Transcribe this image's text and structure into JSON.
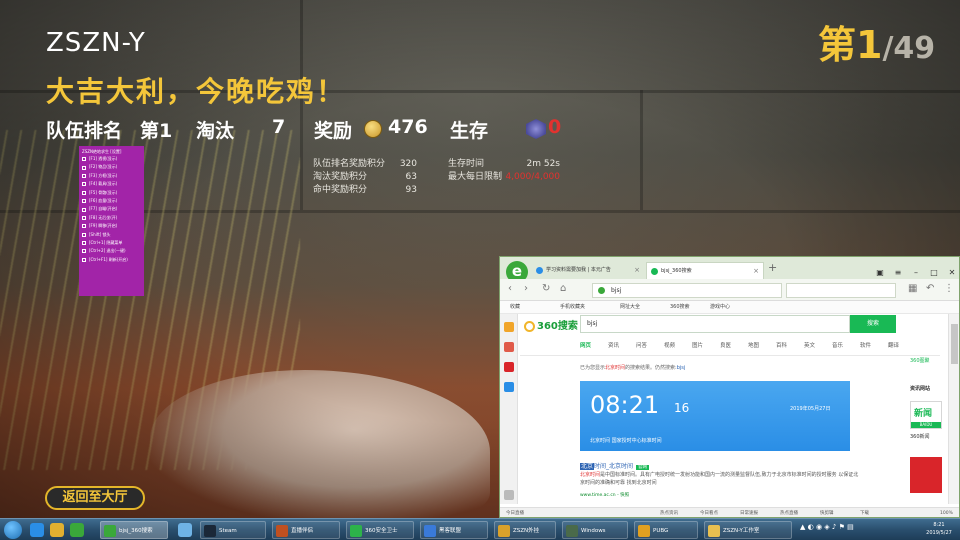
{
  "hud": {
    "player_name": "ZSZN-Y",
    "headline": "大吉大利，今晚吃鸡！",
    "rank_current": "第1",
    "rank_total": "/49",
    "team_rank_label": "队伍排名",
    "team_rank_value": "第1",
    "kills_label": "淘汰",
    "kills_value": "7",
    "reward_label": "奖励",
    "reward_value": "476",
    "survive_label": "生存",
    "survive_value": "0",
    "details_left": [
      {
        "label": "队伍排名奖励积分",
        "value": "320"
      },
      {
        "label": "淘汰奖励积分",
        "value": "63"
      },
      {
        "label": "命中奖励积分",
        "value": "93"
      }
    ],
    "details_right": [
      {
        "label": "生存时间",
        "value": "2m 52s"
      },
      {
        "label": "最大每日限制",
        "value": "4,000/4,000"
      }
    ],
    "back_button": "返回至大厅",
    "colors": {
      "gold": "#f4c63a",
      "red": "#e2322f"
    }
  },
  "mod_menu": {
    "title": "ZSZN绝地求生 [设置]",
    "items": [
      "[F1] 透视(显示)",
      "[F2] 物品(显示)",
      "[F3] 方框(显示)",
      "[F4] 载具(显示)",
      "[F5] 骨骼(显示)",
      "[F6] 血量(显示)",
      "[F7] 自瞄(开启)",
      "[F8] 无后坐(开)",
      "[F9] 瞬移(开启)",
      "[Shift] 锁头",
      "[Ctrl+1] 隐藏菜单",
      "[Ctrl+2] 退出(一键)",
      "[Ctrl+F1] 刷新(开启)"
    ]
  },
  "browser": {
    "tab1": "学习资料需要加我 | 本元广告",
    "tab2": "bjsj_360搜索",
    "address": "bjsj",
    "favorites": [
      "收藏",
      "手机收藏夹",
      "网址大全",
      "360搜索",
      "游戏中心"
    ],
    "search_logo": "360搜索",
    "search_query": "bjsj",
    "search_button": "搜索",
    "search_tabs": [
      "网页",
      "资讯",
      "问答",
      "视频",
      "图片",
      "良医",
      "地图",
      "百科",
      "英文",
      "音乐",
      "软件",
      "翻译"
    ],
    "result_note_prefix": "已为您显示",
    "result_note_keyword": "北京时间",
    "result_note_mid": "的搜索结果。仍然搜索:",
    "result_note_link": "bjsj",
    "clock_time": "08:21",
    "clock_seconds": "16",
    "clock_date": "2019年05月27日",
    "clock_source": "北京时间 国家授时中心标准时间",
    "result_title_hl": "北京",
    "result_title_rest": "时间_北京时间",
    "result_tag": "官网",
    "result_body_kw": "北京时间",
    "result_body": "是中国标准时间。具有广电授时统一发射功能和国内一流的测量监督队伍,致力于北京市标准时间的授时服务 以保证北京时间的准确和可靠 找到北京时间",
    "result_url": "www.time.ac.cn - 快照",
    "right_title": "360图聚",
    "right_sub": "资讯网站",
    "news_word": "新闻",
    "news_sub": "BAIDU",
    "news_caption": "360新闻",
    "status_items": [
      "今日直播",
      "热点资讯",
      "今日看点",
      "日常速报",
      "热点直播",
      "快剪辑",
      "下载",
      "100%"
    ]
  },
  "taskbar": {
    "tasks": [
      "bjsj_360搜索",
      "Steam",
      "直播伴侣",
      "360安全卫士",
      "黑客联盟",
      "ZSZN外挂",
      "Windows",
      "PUBG",
      "ZSZN-Y工作室"
    ],
    "time": "8:21",
    "date": "2019/5/27"
  }
}
